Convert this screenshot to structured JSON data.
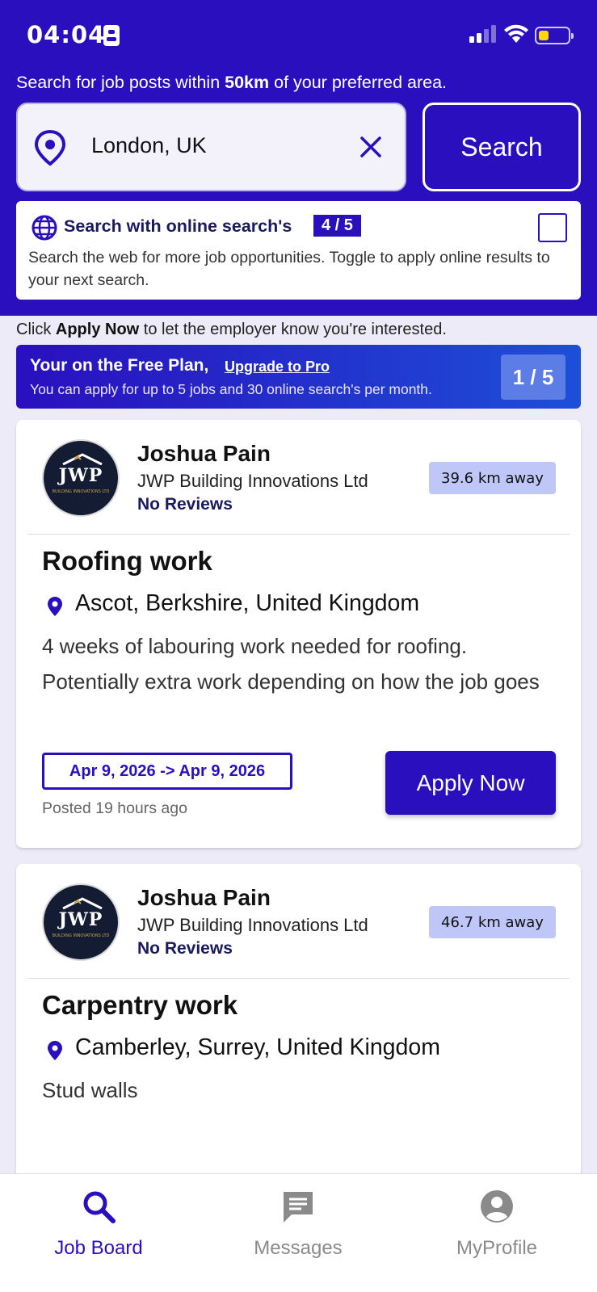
{
  "status_bar": {
    "time": "04:04"
  },
  "search": {
    "hint_prefix": "Search for job posts within ",
    "hint_radius": "50km",
    "hint_suffix": " of your preferred area.",
    "location_value": "London, UK",
    "button_label": "Search"
  },
  "online_search": {
    "title": "Search with online search's",
    "count": "4 / 5",
    "description": "Search the web for more job opportunities. Toggle to apply online results to your next search.",
    "checked": false
  },
  "apply_hint": {
    "prefix": "Click ",
    "strong": "Apply Now",
    "suffix": " to let the employer know you're interested."
  },
  "plan": {
    "title": "Your on the Free Plan,",
    "link": "Upgrade to Pro",
    "subtitle": "You can apply for up to 5 jobs and 30 online search's per month.",
    "count": "1 / 5"
  },
  "jobs": [
    {
      "logo_text": "JWP",
      "logo_sub": "BUILDING INNOVATIONS LTD",
      "owner": "Joshua Pain",
      "company": "JWP Building Innovations Ltd",
      "reviews": "No Reviews",
      "distance": "39.6 km away",
      "title": "Roofing work",
      "location": "Ascot, Berkshire, United Kingdom",
      "description": "4 weeks of labouring work needed for roofing. Potentially extra work depending on how the job goes",
      "dates": "Apr 9, 2026 ->  Apr 9, 2026",
      "posted": "Posted 19 hours ago",
      "apply_label": "Apply Now"
    },
    {
      "logo_text": "JWP",
      "logo_sub": "BUILDING INNOVATIONS LTD",
      "owner": "Joshua Pain",
      "company": "JWP Building Innovations Ltd",
      "reviews": "No Reviews",
      "distance": "46.7 km away",
      "title": "Carpentry work",
      "location": "Camberley, Surrey, United Kingdom",
      "description": "Stud walls"
    }
  ],
  "tabs": [
    {
      "label": "Job Board",
      "icon": "search-icon",
      "active": true
    },
    {
      "label": "Messages",
      "icon": "message-icon",
      "active": false
    },
    {
      "label": "MyProfile",
      "icon": "profile-icon",
      "active": false
    }
  ],
  "colors": {
    "primary": "#2a0fbf",
    "background": "#ecebf7",
    "distance_badge": "#bec7f7"
  }
}
